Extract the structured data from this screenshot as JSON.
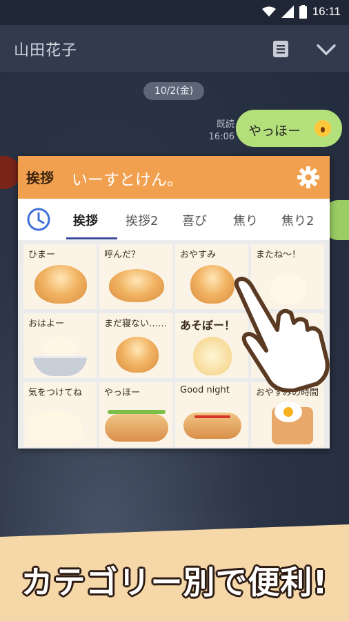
{
  "status_bar": {
    "time": "16:11"
  },
  "chat": {
    "contact_name": "山田花子",
    "date_pill": "10/2(金)",
    "read_label": "既読",
    "sent_time": "16:06",
    "message_text": "やっほー"
  },
  "sticker_panel": {
    "header_category": "挨拶",
    "header_title": "いーすとけん。",
    "tabs": [
      "挨拶",
      "挨拶2",
      "喜び",
      "焦り",
      "焦り2"
    ],
    "active_tab": "挨拶",
    "stickers": [
      {
        "caption": "ひまー"
      },
      {
        "caption": "呼んだ？"
      },
      {
        "caption": "おやすみ"
      },
      {
        "caption": "またね～！"
      },
      {
        "caption": "おはよー"
      },
      {
        "caption": "まだ寝ない……"
      },
      {
        "caption": "あそぼー！"
      },
      {
        "caption": ""
      },
      {
        "caption": "気をつけてね"
      },
      {
        "caption": "やっほー"
      },
      {
        "caption": "Good night"
      },
      {
        "caption": "おやすみの時間"
      }
    ]
  },
  "banner": {
    "text": "カテゴリー別で便利!"
  },
  "colors": {
    "panel_header": "#f0a04e",
    "bubble": "#b4e07c",
    "tab_underline": "#3b4a9a",
    "clock_icon": "#3f6fd8",
    "banner_bg": "#f6d8a8"
  }
}
